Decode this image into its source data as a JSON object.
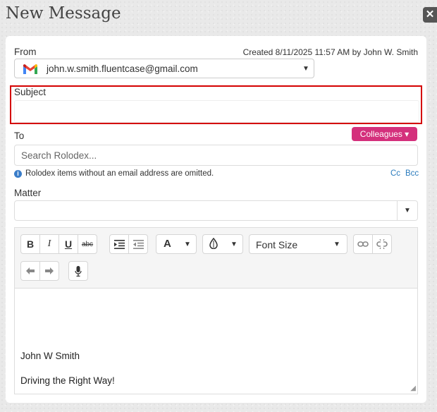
{
  "dialog": {
    "title": "New Message",
    "close_icon": "close-icon"
  },
  "from": {
    "label": "From",
    "created": "Created 8/11/2025 11:57 AM by John W. Smith",
    "account": "john.w.smith.fluentcase@gmail.com",
    "icon": "gmail-icon"
  },
  "subject": {
    "label": "Subject",
    "value": ""
  },
  "to": {
    "label": "To",
    "colleagues_label": "Colleagues ▾",
    "search_placeholder": "Search Rolodex...",
    "note": "Rolodex items without an email address are omitted.",
    "cc_label": "Cc",
    "bcc_label": "Bcc"
  },
  "matter": {
    "label": "Matter",
    "value": ""
  },
  "toolbar": {
    "bold": "B",
    "italic": "I",
    "underline": "U",
    "strike": "abc",
    "font_size_label": "Font Size",
    "font_color": "A"
  },
  "body": {
    "lines": [
      "John W Smith",
      "Driving the Right Way!"
    ]
  },
  "colors": {
    "accent": "#d4307c",
    "highlight": "#d40000",
    "link": "#2a7bbd"
  }
}
